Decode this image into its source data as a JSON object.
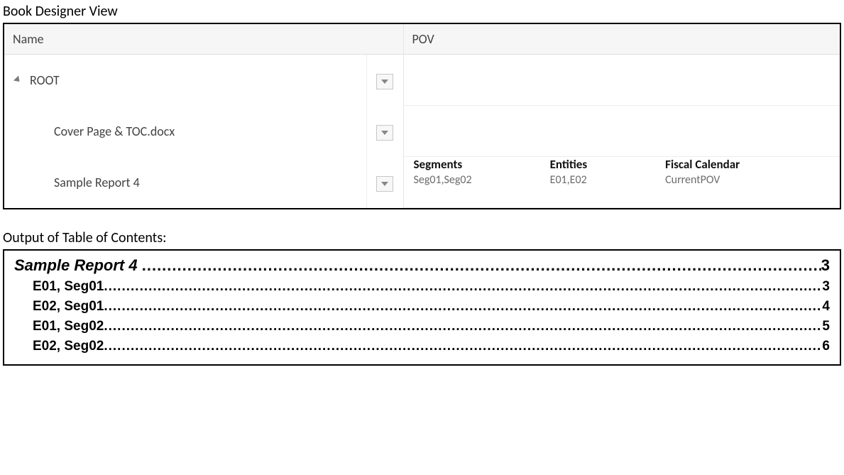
{
  "designer": {
    "title": "Book Designer View",
    "columns": {
      "name": "Name",
      "pov": "POV"
    },
    "rows": [
      {
        "label": "ROOT",
        "indent": 0,
        "expandable": true,
        "pov": null
      },
      {
        "label": "Cover Page & TOC.docx",
        "indent": 1,
        "expandable": false,
        "pov": null
      },
      {
        "label": "Sample Report 4",
        "indent": 1,
        "expandable": false,
        "pov": [
          {
            "label": "Segments",
            "value": "Seg01,Seg02"
          },
          {
            "label": "Entities",
            "value": "E01,E02"
          },
          {
            "label": "Fiscal Calendar",
            "value": "CurrentPOV"
          }
        ]
      }
    ]
  },
  "toc": {
    "title": "Output of Table of Contents:",
    "entries": [
      {
        "label": "Sample Report 4",
        "page": "3",
        "level": 0
      },
      {
        "label": "E01, Seg01",
        "page": "3",
        "level": 1
      },
      {
        "label": "E02, Seg01",
        "page": "4",
        "level": 1
      },
      {
        "label": "E01, Seg02",
        "page": "5",
        "level": 1
      },
      {
        "label": "E02, Seg02",
        "page": "6",
        "level": 1
      }
    ]
  }
}
